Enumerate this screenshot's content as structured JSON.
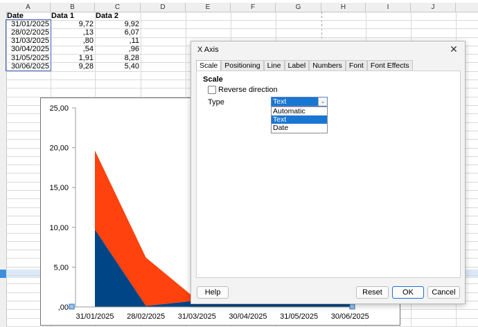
{
  "sheet": {
    "columns": [
      "A",
      "B",
      "C",
      "D",
      "E",
      "F",
      "G",
      "H",
      "I",
      "J"
    ],
    "headers": [
      "Date",
      "Data 1",
      "Data 2"
    ],
    "rows": [
      {
        "date": "31/01/2025",
        "d1": "9,72",
        "d2": "9,92"
      },
      {
        "date": "28/02/2025",
        "d1": ",13",
        "d2": "6,07"
      },
      {
        "date": "31/03/2025",
        "d1": ",80",
        "d2": ",11"
      },
      {
        "date": "30/04/2025",
        "d1": ",54",
        "d2": ",96"
      },
      {
        "date": "31/05/2025",
        "d1": "1,91",
        "d2": "8,28"
      },
      {
        "date": "30/06/2025",
        "d1": "9,28",
        "d2": "5,40"
      }
    ]
  },
  "chart_data": {
    "type": "area",
    "categories": [
      "31/01/2025",
      "28/02/2025",
      "31/03/2025",
      "30/04/2025",
      "31/05/2025",
      "30/06/2025"
    ],
    "series": [
      {
        "name": "Data 1",
        "values": [
          9.72,
          0.13,
          0.8,
          0.54,
          1.91,
          9.28
        ],
        "color": "#004586"
      },
      {
        "name": "Data 2",
        "values": [
          9.92,
          6.07,
          0.11,
          0.96,
          8.28,
          5.4
        ],
        "color": "#ff420e"
      }
    ],
    "stacked": true,
    "ylim": [
      0,
      25
    ],
    "yticks": [
      "25,00",
      "20,00",
      "15,00",
      "10,00",
      "5,00",
      ",00"
    ],
    "xlabel": "",
    "ylabel": "",
    "title": ""
  },
  "dialog": {
    "title": "X Axis",
    "close_icon": "close-icon",
    "tabs": [
      "Scale",
      "Positioning",
      "Line",
      "Label",
      "Numbers",
      "Font",
      "Font Effects"
    ],
    "active_tab": "Scale",
    "section_title": "Scale",
    "reverse_label": "Reverse direction",
    "reverse_checked": false,
    "type_label": "Type",
    "type_value": "Text",
    "type_options": [
      "Automatic",
      "Text",
      "Date"
    ],
    "buttons": {
      "help": "Help",
      "reset": "Reset",
      "ok": "OK",
      "cancel": "Cancel"
    }
  }
}
